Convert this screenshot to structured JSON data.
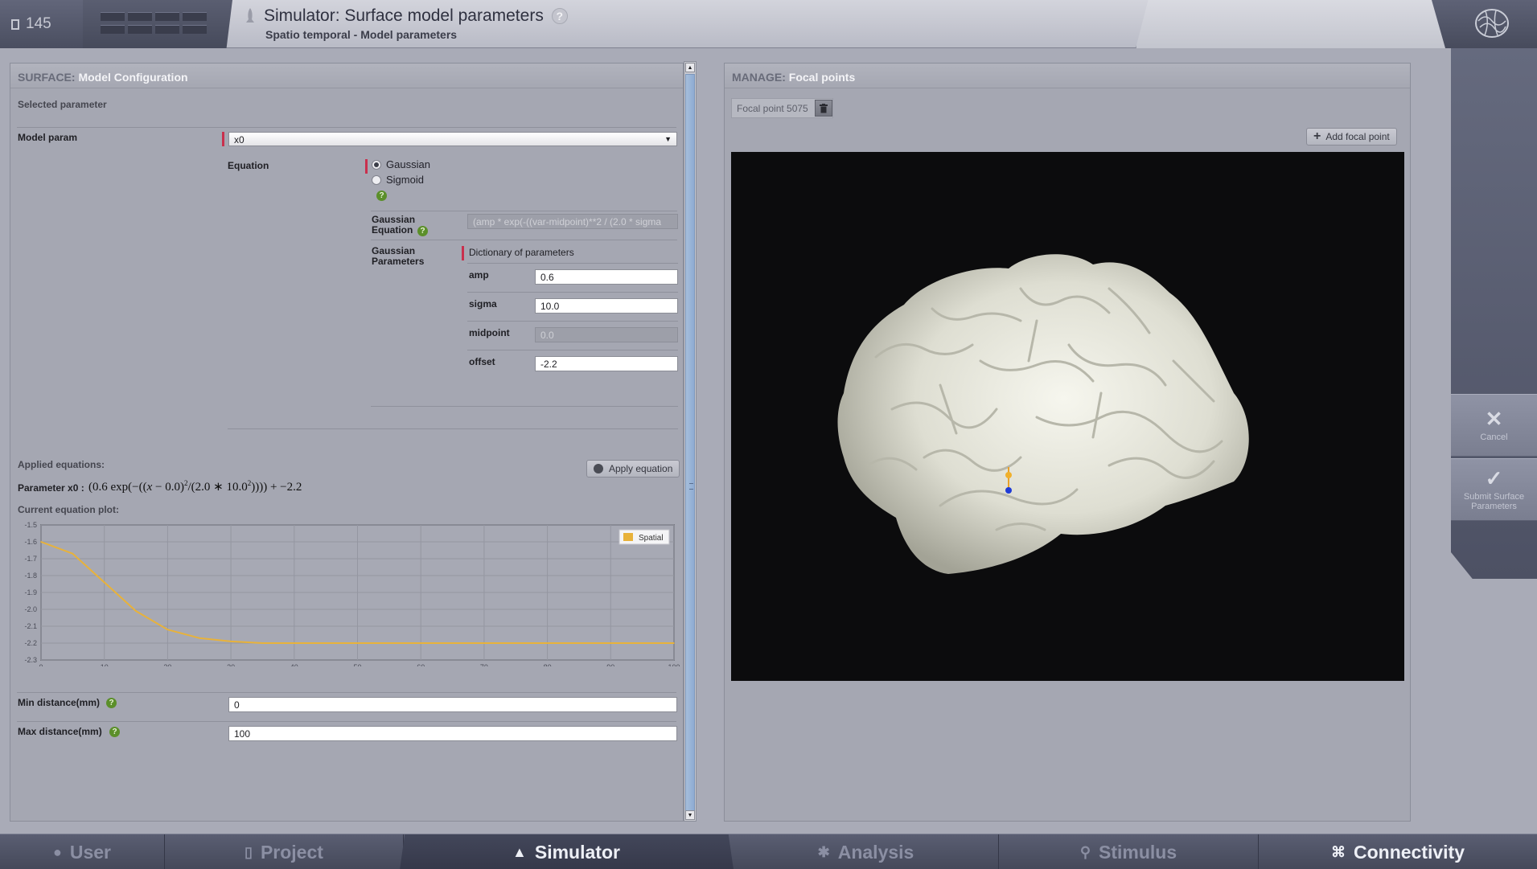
{
  "header": {
    "project_id": "145",
    "title": "Simulator: Surface model parameters",
    "help": "?",
    "subtitle": "Spatio temporal - Model parameters"
  },
  "surface": {
    "title_key": "SURFACE:",
    "title": "Model Configuration",
    "selected_parameter": "Selected parameter",
    "model_param_label": "Model param",
    "model_param_value": "x0",
    "equation_label": "Equation",
    "eq_options": [
      "Gaussian",
      "Sigmoid"
    ],
    "eq_selected": "Gaussian",
    "gaussian_equation_label": "Gaussian Equation",
    "gaussian_equation_value": "(amp * exp(-((var-midpoint)**2 / (2.0 * sigma",
    "gaussian_parameters_label": "Gaussian Parameters",
    "dict_label": "Dictionary of parameters",
    "params": [
      {
        "name": "amp",
        "value": "0.6",
        "disabled": false
      },
      {
        "name": "sigma",
        "value": "10.0",
        "disabled": false
      },
      {
        "name": "midpoint",
        "value": "0.0",
        "disabled": true
      },
      {
        "name": "offset",
        "value": "-2.2",
        "disabled": false
      }
    ],
    "applied_equations": "Applied equations:",
    "apply_button": "Apply equation",
    "parameter_label": "Parameter x0 :",
    "current_plot": "Current equation plot:",
    "min_distance_label": "Min distance(mm)",
    "min_distance_value": "0",
    "max_distance_label": "Max distance(mm)",
    "max_distance_value": "100"
  },
  "chart_data": {
    "type": "line",
    "title": "",
    "xlabel": "",
    "ylabel": "",
    "xlim": [
      0,
      100
    ],
    "ylim": [
      -2.3,
      -1.5
    ],
    "x_ticks": [
      0,
      10,
      20,
      30,
      40,
      50,
      60,
      70,
      80,
      90,
      100
    ],
    "y_ticks": [
      -1.5,
      -1.6,
      -1.7,
      -1.8,
      -1.9,
      -2.0,
      -2.1,
      -2.2,
      -2.3
    ],
    "grid": true,
    "legend_position": "top-right",
    "series": [
      {
        "name": "Spatial",
        "color": "#e8b23a",
        "x": [
          0,
          5,
          10,
          15,
          20,
          25,
          30,
          35,
          40,
          50,
          60,
          70,
          80,
          90,
          100
        ],
        "y": [
          -1.6,
          -1.67,
          -1.84,
          -2.01,
          -2.12,
          -2.17,
          -2.19,
          -2.2,
          -2.2,
          -2.2,
          -2.2,
          -2.2,
          -2.2,
          -2.2,
          -2.2
        ]
      }
    ]
  },
  "manage": {
    "title_key": "MANAGE:",
    "title": "Focal points",
    "focal_point": "Focal point 5075",
    "add_button": "Add focal point"
  },
  "side": {
    "cancel": "Cancel",
    "submit": "Submit Surface Parameters"
  },
  "nav": {
    "tabs": [
      "User",
      "Project",
      "Simulator",
      "Analysis",
      "Stimulus",
      "Connectivity"
    ],
    "active": "Simulator"
  },
  "colors": {
    "accent_required": "#c9304d",
    "help_green": "#5b8f2a",
    "series": "#e8b23a"
  }
}
